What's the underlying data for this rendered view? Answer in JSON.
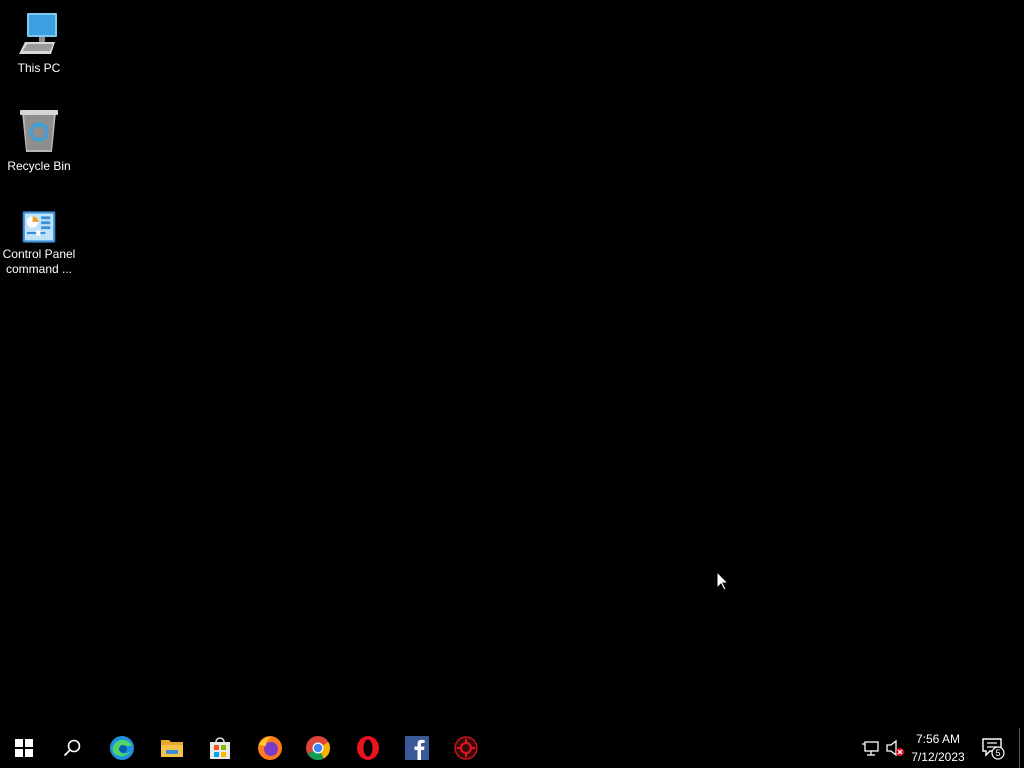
{
  "desktop": {
    "icons": [
      {
        "label": "This PC",
        "icon": "this-pc-icon"
      },
      {
        "label": "Recycle Bin",
        "icon": "recycle-bin-icon"
      },
      {
        "label_line1": "Control Panel",
        "label_line2": "command ...",
        "icon": "control-panel-icon"
      }
    ]
  },
  "taskbar": {
    "apps": [
      {
        "name": "start",
        "icon": "windows-logo-icon"
      },
      {
        "name": "search",
        "icon": "search-icon"
      },
      {
        "name": "edge",
        "icon": "edge-icon"
      },
      {
        "name": "file-explorer",
        "icon": "folder-icon"
      },
      {
        "name": "store",
        "icon": "store-icon"
      },
      {
        "name": "firefox",
        "icon": "firefox-icon"
      },
      {
        "name": "chrome",
        "icon": "chrome-icon"
      },
      {
        "name": "opera",
        "icon": "opera-icon"
      },
      {
        "name": "facebook",
        "icon": "facebook-icon"
      },
      {
        "name": "app",
        "icon": "red-app-icon"
      }
    ],
    "tray": {
      "time": "7:56 AM",
      "date": "7/12/2023",
      "notification_count": "5"
    }
  },
  "colors": {
    "background": "#000000",
    "edge_blue": "#1f8fe0",
    "folder_yellow": "#f3c34b",
    "facebook_blue": "#3b5998",
    "opera_red": "#e8141f"
  }
}
